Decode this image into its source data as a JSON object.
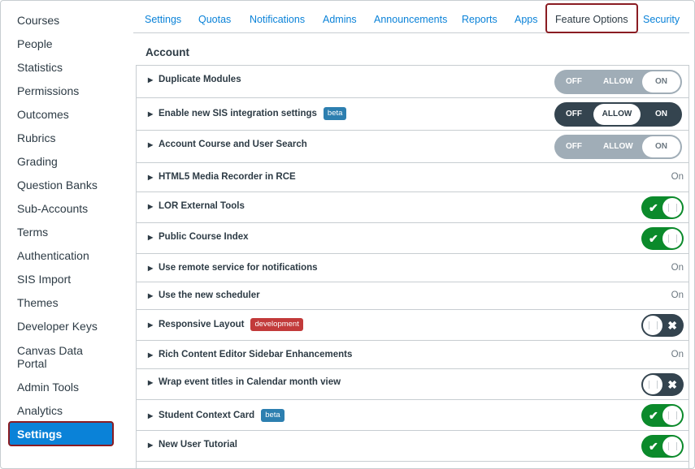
{
  "sidebar": {
    "items": [
      {
        "label": "Courses"
      },
      {
        "label": "People"
      },
      {
        "label": "Statistics"
      },
      {
        "label": "Permissions"
      },
      {
        "label": "Outcomes"
      },
      {
        "label": "Rubrics"
      },
      {
        "label": "Grading"
      },
      {
        "label": "Question Banks"
      },
      {
        "label": "Sub-Accounts"
      },
      {
        "label": "Terms"
      },
      {
        "label": "Authentication"
      },
      {
        "label": "SIS Import"
      },
      {
        "label": "Themes"
      },
      {
        "label": "Developer Keys"
      },
      {
        "label": "Canvas Data",
        "label2": "Portal"
      },
      {
        "label": "Admin Tools"
      },
      {
        "label": "Analytics"
      },
      {
        "label": "Settings",
        "active": true
      }
    ]
  },
  "tabs": [
    {
      "label": "Settings"
    },
    {
      "label": "Quotas"
    },
    {
      "label": "Notifications"
    },
    {
      "label": "Admins"
    },
    {
      "label": "Announcements"
    },
    {
      "label": "Reports"
    },
    {
      "label": "Apps"
    },
    {
      "label": "Feature Options",
      "active": true
    },
    {
      "label": "Security"
    }
  ],
  "section_title": "Account",
  "switch_labels": {
    "off": "OFF",
    "allow": "ALLOW",
    "on": "ON"
  },
  "features": [
    {
      "label": "Duplicate Modules",
      "control": "tri",
      "state": "ON"
    },
    {
      "label": "Enable new SIS integration settings",
      "pill": "beta",
      "control": "tri",
      "state": "ALLOW"
    },
    {
      "label": "Account Course and User Search",
      "control": "tri",
      "state": "ON"
    },
    {
      "label": "HTML5 Media Recorder in RCE",
      "control": "text",
      "state": "On"
    },
    {
      "label": "LOR External Tools",
      "control": "toggle",
      "state": "on"
    },
    {
      "label": "Public Course Index",
      "control": "toggle",
      "state": "on"
    },
    {
      "label": "Use remote service for notifications",
      "control": "text",
      "state": "On"
    },
    {
      "label": "Use the new scheduler",
      "control": "text",
      "state": "On"
    },
    {
      "label": "Responsive Layout",
      "pill": "development",
      "control": "toggle",
      "state": "off"
    },
    {
      "label": "Rich Content Editor Sidebar Enhancements",
      "control": "text",
      "state": "On"
    },
    {
      "label": "Wrap event titles in Calendar month view",
      "control": "toggle",
      "state": "off"
    },
    {
      "label": "Student Context Card",
      "pill": "beta",
      "control": "toggle",
      "state": "on"
    },
    {
      "label": "New User Tutorial",
      "control": "toggle",
      "state": "on"
    }
  ],
  "icons": {
    "expand": "caret-right-icon",
    "check": "check-icon",
    "x": "x-icon"
  },
  "colors": {
    "accent": "#0a82d8",
    "highlight_border": "#8a1c22",
    "toggle_on": "#0b8a2b",
    "toggle_off": "#34444f",
    "beta": "#2d7fb0",
    "development": "#c23a3a"
  }
}
